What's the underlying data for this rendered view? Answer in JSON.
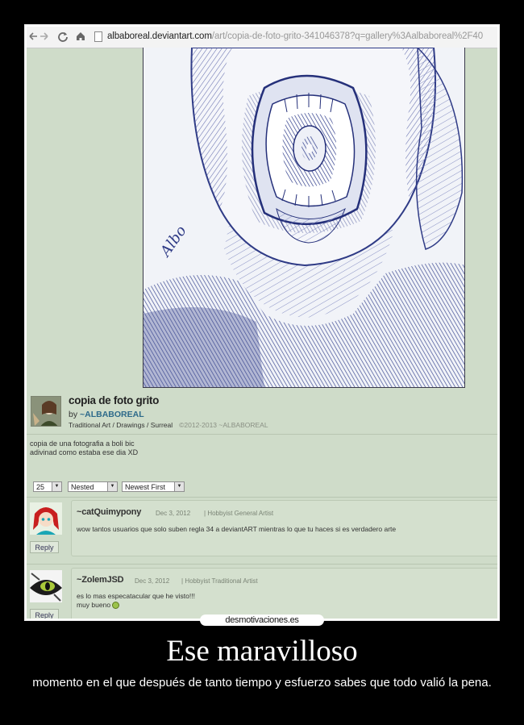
{
  "browser": {
    "back_icon": "arrow-left-icon",
    "forward_icon": "arrow-right-icon",
    "reload_icon": "reload-icon",
    "home_icon": "home-icon",
    "url_host": "albaboreal.deviantart.com",
    "url_path": "/art/copia-de-foto-grito-341046378?q=gallery%3Aalbaboreal%2F40"
  },
  "artwork": {
    "signature": "Albo"
  },
  "deviation": {
    "title": "copia de foto grito",
    "by_label": "by",
    "author": "~ALBABOREAL",
    "categories": "Traditional Art / Drawings / Surreal",
    "copyright": "©2012-2013 ~ALBABOREAL",
    "description_line1": "copia de una fotografia a boli bic",
    "description_line2": "adivinad como estaba ese dia XD"
  },
  "comment_controls": {
    "per_page": "25",
    "thread_mode": "Nested",
    "sort_order": "Newest First"
  },
  "comments": [
    {
      "user": "~catQuimypony",
      "date": "Dec 3, 2012",
      "role": "Hobbyist General Artist",
      "text": "wow tantos usuarios que solo suben regla 34 a deviantART mientras lo que tu haces si es verdadero arte",
      "reply_label": "Reply"
    },
    {
      "user": "~ZolemJSD",
      "date": "Dec 3, 2012",
      "role": "Hobbyist Traditional Artist",
      "text_line1": "es lo mas especatacular que he visto!!!",
      "text_line2": "muy bueno",
      "reply_label": "Reply"
    }
  ],
  "poster": {
    "watermark": "desmotivaciones.es",
    "headline": "Ese maravilloso",
    "caption": "momento en el que después de tanto tiempo y esfuerzo sabes que todo valió la pena."
  },
  "colors": {
    "poster_background": "#000000",
    "page_background": "#cfdcc9",
    "ink_blue": "#2c3a8a",
    "link_blue": "#2d6a8a"
  }
}
